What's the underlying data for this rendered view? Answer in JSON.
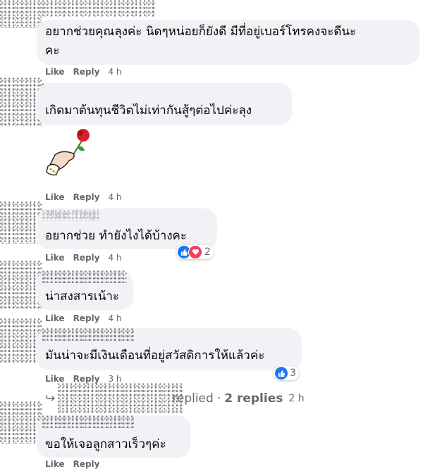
{
  "comments": [
    {
      "line1": "อยากช่วยคุณลุงค่ะ นิดๆหน่อยก็ยังดี มีที่อยู่เบอร์โทรคงจะดีนะ",
      "line2": "คะ",
      "like": "Like",
      "reply": "Reply",
      "time": "4 h"
    },
    {
      "text": "เกิดมาต้นทุนชีวิตไม่เท่ากันสู้ๆต่อไปค่ะลุง",
      "like": "Like",
      "reply": "Reply",
      "time": "4 h"
    },
    {
      "name_faint": "Mae Ying",
      "text": "อยากช่วย ทำยังไงได้บ้างคะ",
      "reactions": "2",
      "like": "Like",
      "reply": "Reply",
      "time": "4 h"
    },
    {
      "text": "น่าสงสารเน้าะ",
      "like": "Like",
      "reply": "Reply",
      "time": "4 h"
    },
    {
      "text": "มันน่าจะมีเงินเดือนที่อยู่สวัสดิการให้แล้วค่ะ",
      "reactions": "3",
      "like": "Like",
      "reply": "Reply",
      "time": "3 h"
    },
    {
      "text": "ขอให้เจอลูกสาวเร็วๆค่ะ",
      "like": "Like",
      "reply": "Reply",
      "time": ""
    }
  ],
  "sticker": {
    "icon": "hand-holding-rose-sticker"
  },
  "replies_row": {
    "arrow": "↪",
    "replied": "replied",
    "sep": "·",
    "count": "2 replies",
    "time": "2 h"
  },
  "colors": {
    "bubble": "#f0f2f5",
    "meta": "#65676b",
    "like_blue": "#1877f2",
    "love_red": "#f33e58"
  }
}
